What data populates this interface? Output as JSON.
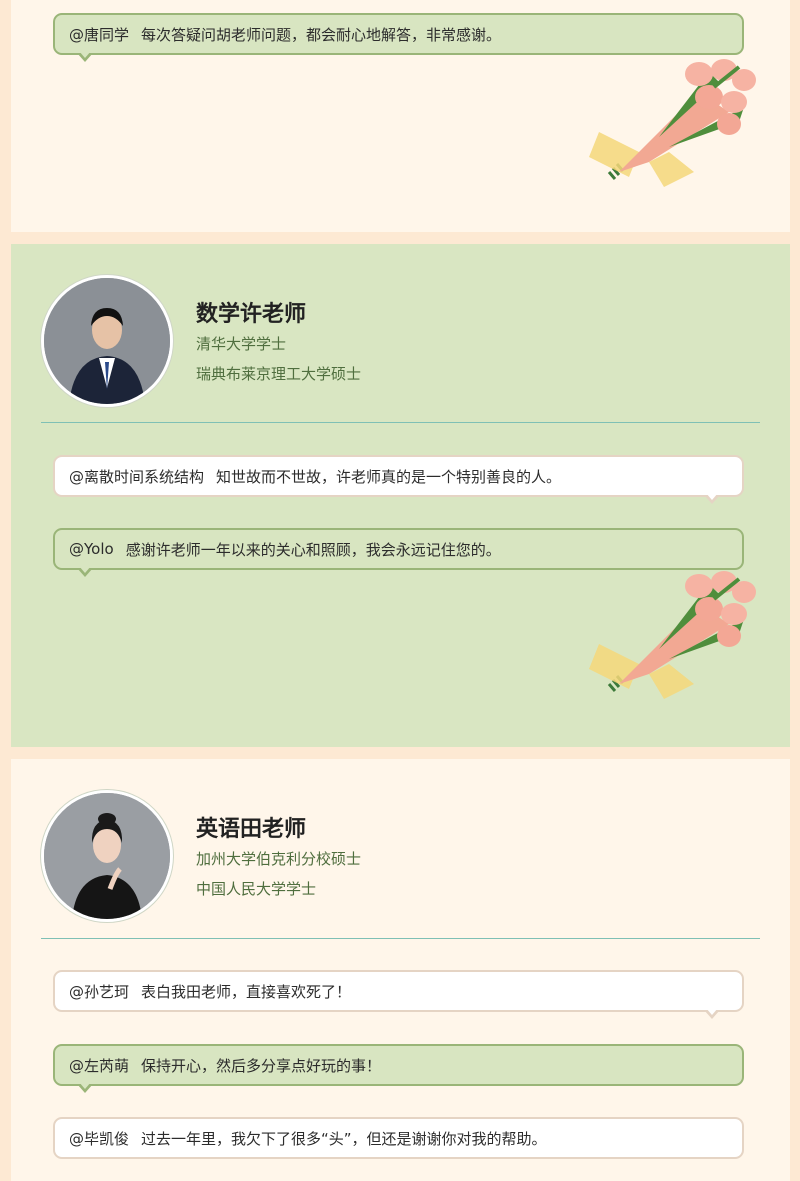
{
  "card0": {
    "comments": [
      {
        "user": "@唐同学",
        "text": "每次答疑问胡老师问题，都会耐心地解答，非常感谢。"
      }
    ]
  },
  "card1": {
    "name": "数学许老师",
    "credentials": [
      "清华大学学士",
      "瑞典布莱京理工大学硕士"
    ],
    "comments": [
      {
        "user": "@离散时间系统结构",
        "text": "知世故而不世故，许老师真的是一个特别善良的人。"
      },
      {
        "user": "@Yolo",
        "text": "感谢许老师一年以来的关心和照顾，我会永远记住您的。"
      }
    ]
  },
  "card2": {
    "name": "英语田老师",
    "credentials": [
      "加州大学伯克利分校硕士",
      "中国人民大学学士"
    ],
    "comments": [
      {
        "user": "@孙艺珂",
        "text": "表白我田老师，直接喜欢死了！"
      },
      {
        "user": "@左芮萌",
        "text": "保持开心，然后多分享点好玩的事！"
      },
      {
        "user": "@毕凯俊",
        "text": "过去一年里，我欠下了很多“头”，但还是谢谢你对我的帮助。"
      }
    ]
  },
  "colors": {
    "page_bg": "#fde9d3",
    "cream_card": "#fff6ea",
    "green_card": "#d9e6c2",
    "bubble_green": "#d8e5c1",
    "bubble_border": "#9ab578",
    "divider": "#7fc0b5",
    "credential_text": "#4f6e3e"
  },
  "icons": [
    "tulip-bouquet-icon",
    "teacher-avatar"
  ]
}
